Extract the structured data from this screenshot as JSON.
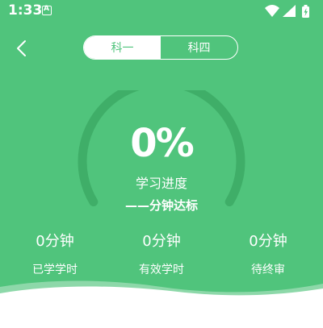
{
  "status_bar": {
    "time": "1:33",
    "app_icon_letter": "A"
  },
  "header": {
    "tabs": [
      {
        "label": "科一",
        "active": true
      },
      {
        "label": "科四",
        "active": false
      }
    ]
  },
  "progress": {
    "percent_text": "0%",
    "value": 0,
    "label": "学习进度",
    "target": "——分钟达标"
  },
  "stats": [
    {
      "value": "0分钟",
      "label": "已学学时"
    },
    {
      "value": "0分钟",
      "label": "有效学时"
    },
    {
      "value": "0分钟",
      "label": "待终审"
    }
  ],
  "colors": {
    "background": "#50c47c",
    "gauge_track": "#3fae68",
    "wave": "#ffffff"
  }
}
